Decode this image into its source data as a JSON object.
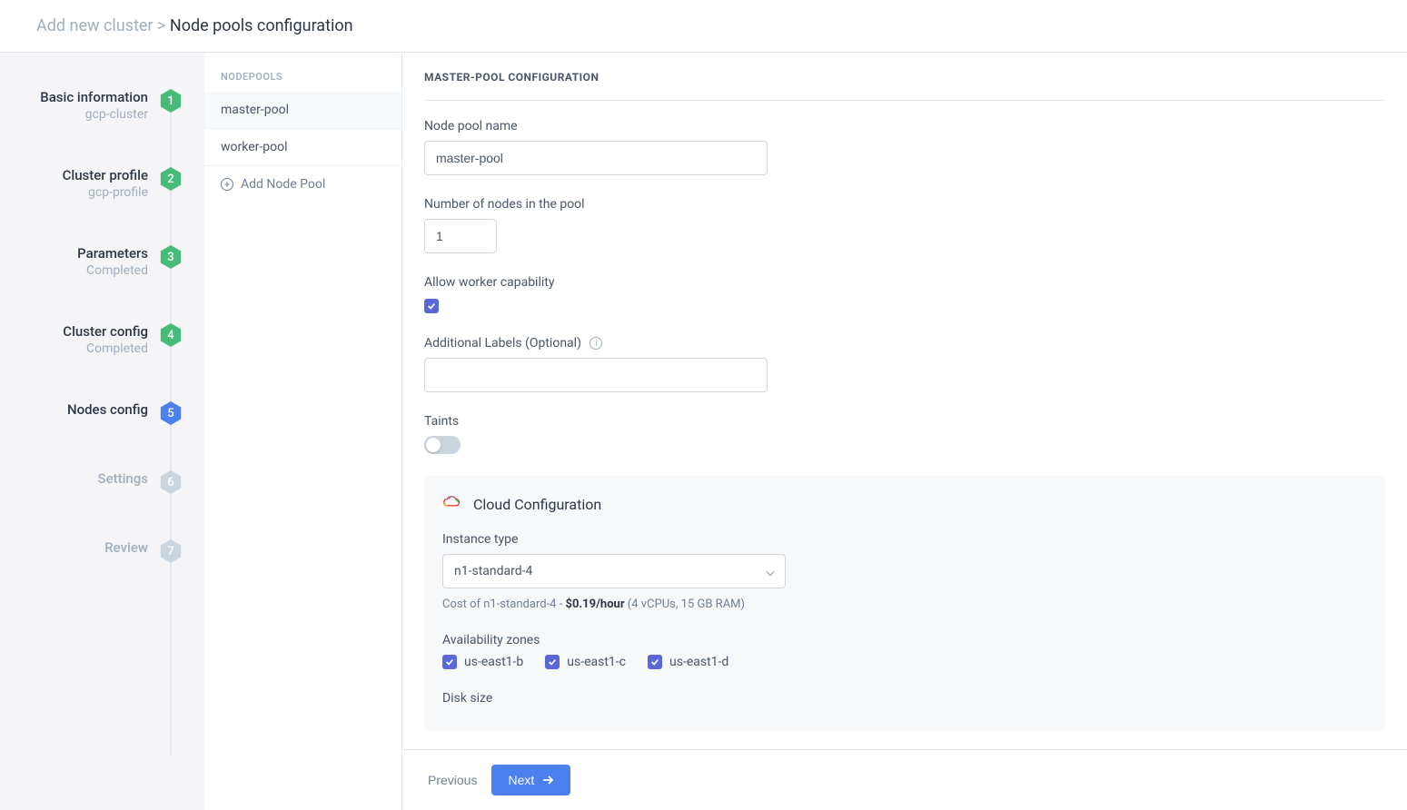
{
  "breadcrumb": {
    "parent": "Add new cluster",
    "separator": ">",
    "current": "Node pools configuration"
  },
  "stepper": {
    "steps": [
      {
        "title": "Basic information",
        "subtitle": "gcp-cluster",
        "badge": "1",
        "status": "completed"
      },
      {
        "title": "Cluster profile",
        "subtitle": "gcp-profile",
        "badge": "2",
        "status": "completed"
      },
      {
        "title": "Parameters",
        "subtitle": "Completed",
        "badge": "3",
        "status": "completed"
      },
      {
        "title": "Cluster config",
        "subtitle": "Completed",
        "badge": "4",
        "status": "completed"
      },
      {
        "title": "Nodes config",
        "subtitle": "",
        "badge": "5",
        "status": "current"
      },
      {
        "title": "Settings",
        "subtitle": "",
        "badge": "6",
        "status": "pending"
      },
      {
        "title": "Review",
        "subtitle": "",
        "badge": "7",
        "status": "pending"
      }
    ]
  },
  "nodepools": {
    "header": "NODEPOOLS",
    "items": [
      {
        "name": "master-pool",
        "active": true
      },
      {
        "name": "worker-pool",
        "active": false
      }
    ],
    "add_label": "Add Node Pool"
  },
  "form": {
    "title": "MASTER-POOL CONFIGURATION",
    "pool_name_label": "Node pool name",
    "pool_name_value": "master-pool",
    "node_count_label": "Number of nodes in the pool",
    "node_count_value": "1",
    "allow_worker_label": "Allow worker capability",
    "allow_worker_checked": true,
    "additional_labels_label": "Additional Labels (Optional)",
    "additional_labels_value": "",
    "taints_label": "Taints",
    "taints_enabled": false,
    "cloud": {
      "title": "Cloud Configuration",
      "instance_type_label": "Instance type",
      "instance_type_value": "n1-standard-4",
      "cost_prefix": "Cost of n1-standard-4 - ",
      "cost_price": "$0.19/hour",
      "cost_suffix": " (4 vCPUs, 15 GB RAM)",
      "zones_label": "Availability zones",
      "zones": [
        {
          "label": "us-east1-b",
          "checked": true
        },
        {
          "label": "us-east1-c",
          "checked": true
        },
        {
          "label": "us-east1-d",
          "checked": true
        }
      ],
      "disk_size_label": "Disk size"
    }
  },
  "footer": {
    "previous": "Previous",
    "next": "Next"
  }
}
